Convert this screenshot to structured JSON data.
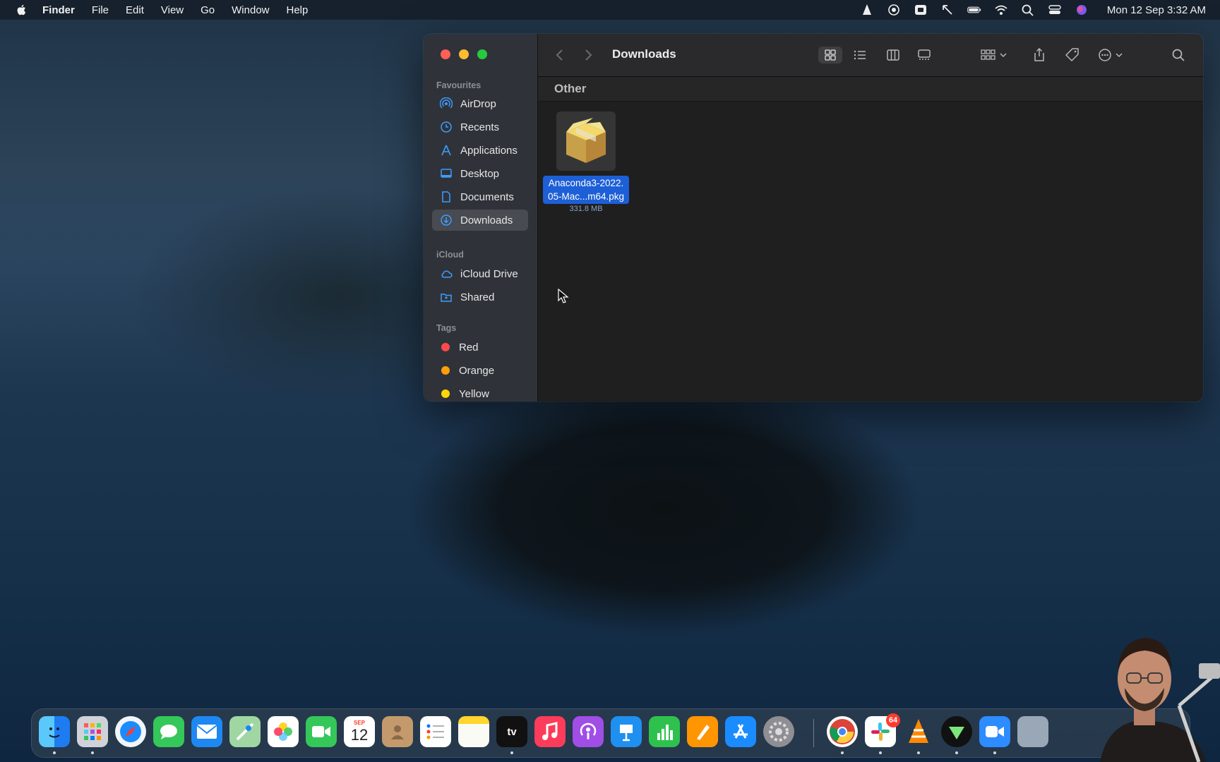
{
  "menubar": {
    "app_name": "Finder",
    "items": [
      "File",
      "Edit",
      "View",
      "Go",
      "Window",
      "Help"
    ],
    "status_icons": [
      "vlc-icon",
      "screen-recording-icon",
      "video-icon",
      "location-icon",
      "battery-icon",
      "wifi-icon",
      "spotlight-search-icon",
      "control-center-icon",
      "siri-icon"
    ],
    "clock": "Mon 12 Sep  3:32 AM"
  },
  "finder": {
    "title": "Downloads",
    "sidebar": {
      "favourites_header": "Favourites",
      "favourites": [
        {
          "label": "AirDrop",
          "icon": "airdrop-icon"
        },
        {
          "label": "Recents",
          "icon": "clock-icon"
        },
        {
          "label": "Applications",
          "icon": "applications-icon"
        },
        {
          "label": "Desktop",
          "icon": "desktop-icon"
        },
        {
          "label": "Documents",
          "icon": "document-icon"
        },
        {
          "label": "Downloads",
          "icon": "downloads-icon",
          "selected": true
        }
      ],
      "icloud_header": "iCloud",
      "icloud": [
        {
          "label": "iCloud Drive",
          "icon": "cloud-icon"
        },
        {
          "label": "Shared",
          "icon": "shared-folder-icon"
        }
      ],
      "tags_header": "Tags",
      "tags": [
        {
          "label": "Red",
          "color": "#ff4a4a"
        },
        {
          "label": "Orange",
          "color": "#ff9f0a"
        },
        {
          "label": "Yellow",
          "color": "#ffd60a"
        }
      ]
    },
    "group_header": "Other",
    "files": [
      {
        "name_line1": "Anaconda3-2022.",
        "name_line2": "05-Mac...m64.pkg",
        "size": "331.8 MB",
        "icon": "package-icon",
        "selected": true
      }
    ]
  },
  "dock": {
    "apps": [
      "Finder",
      "Launchpad",
      "Safari",
      "Messages",
      "Mail",
      "Maps",
      "Photos",
      "FaceTime",
      "Calendar",
      "Contacts",
      "Reminders",
      "Notes",
      "TV",
      "Music",
      "Podcasts",
      "Keynote",
      "Numbers",
      "Pages",
      "App Store",
      "System Preferences",
      "Chrome",
      "Slack",
      "VLC",
      "Tunnel",
      "Zoom",
      "Preview"
    ],
    "calendar_month": "SEP",
    "calendar_day": "12",
    "tv_label": "tv",
    "slack_badge": "64"
  }
}
